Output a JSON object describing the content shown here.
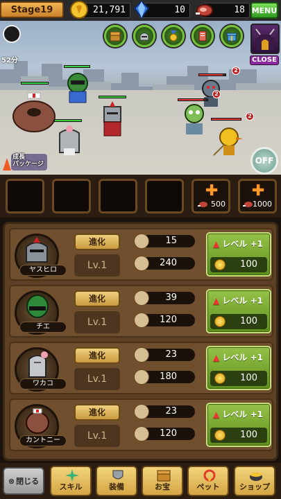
{
  "topbar": {
    "stage": "Stage19",
    "gold": "21,791",
    "gems": "10",
    "meat": "18",
    "menu_label": "MENU"
  },
  "scene": {
    "timer": "52分",
    "close_label": "CLOSE",
    "growth_pack": "成長\nパッケージ",
    "auto_label": "OFF",
    "enemy_badges": [
      "2",
      "2",
      "2"
    ],
    "quick_icons": [
      "treasure-chest-icon",
      "knight-helmet-icon",
      "medal-icon",
      "scroll-icon",
      "gift-box-icon"
    ]
  },
  "slots": {
    "buy_costs": [
      "500",
      "1000"
    ]
  },
  "units": [
    {
      "name": "ヤスヒロ",
      "evolve": "進化",
      "level": "Lv.1",
      "attack": "15",
      "hp": "240",
      "levelup": "レベル +1",
      "cost": "100"
    },
    {
      "name": "チエ",
      "evolve": "進化",
      "level": "Lv.1",
      "attack": "39",
      "hp": "120",
      "levelup": "レベル +1",
      "cost": "100"
    },
    {
      "name": "ワカコ",
      "evolve": "進化",
      "level": "Lv.1",
      "attack": "23",
      "hp": "180",
      "levelup": "レベル +1",
      "cost": "100"
    },
    {
      "name": "カントニー",
      "evolve": "進化",
      "level": "Lv.1",
      "attack": "23",
      "hp": "120",
      "levelup": "レベル +1",
      "cost": "100"
    }
  ],
  "nav": {
    "close": "閉じる",
    "skill": "スキル",
    "equip": "装備",
    "treasure": "お宝",
    "pet": "ペット",
    "shop": "ショップ"
  }
}
